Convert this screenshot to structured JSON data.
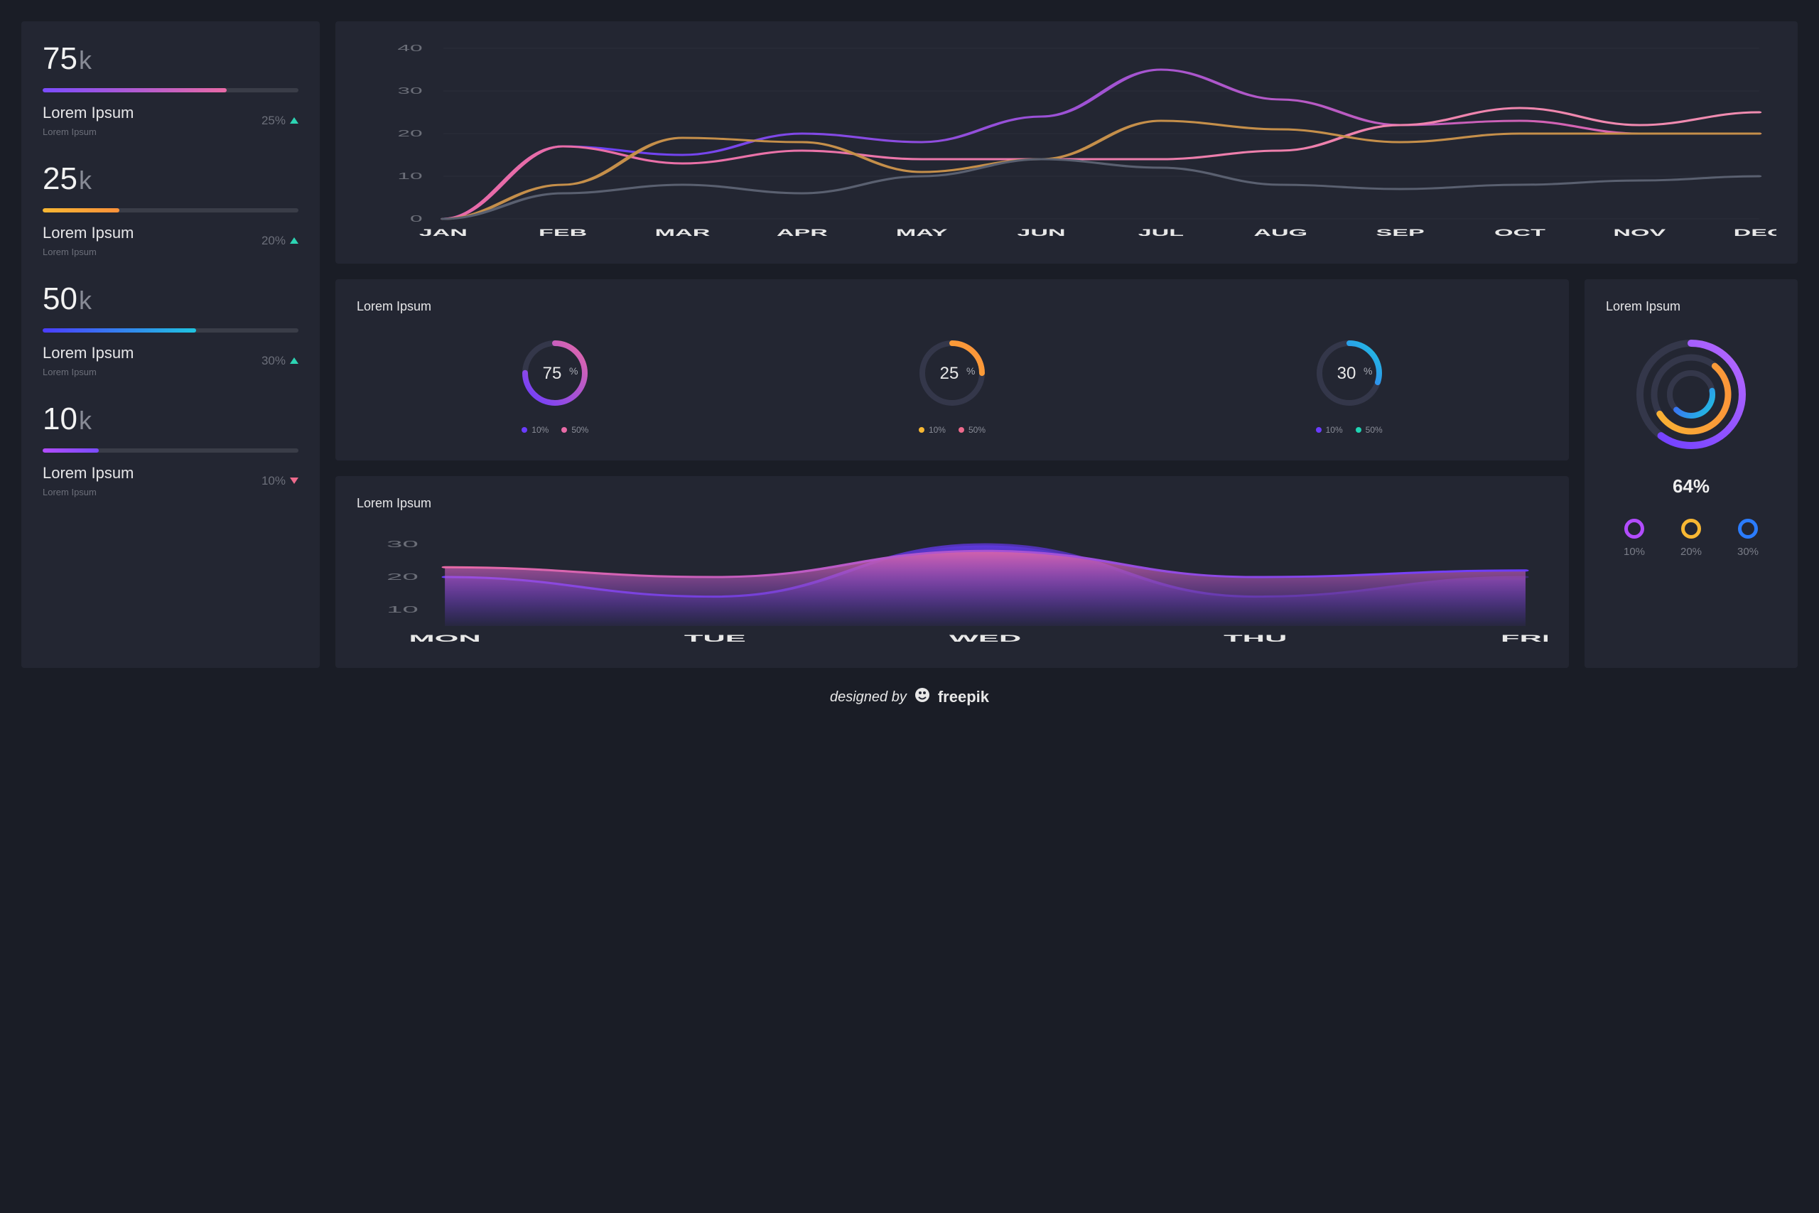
{
  "sidebar": {
    "stats": [
      {
        "value": "75",
        "unit": "k",
        "bar_pct": 72,
        "gradient": [
          "#7a4cff",
          "#e86aa6"
        ],
        "title": "Lorem Ipsum",
        "sub": "Lorem Ipsum",
        "pct": "25%",
        "dir": "up"
      },
      {
        "value": "25",
        "unit": "k",
        "bar_pct": 30,
        "gradient": [
          "#f7b733",
          "#fc913a"
        ],
        "title": "Lorem Ipsum",
        "sub": "Lorem Ipsum",
        "pct": "20%",
        "dir": "up"
      },
      {
        "value": "50",
        "unit": "k",
        "bar_pct": 60,
        "gradient": [
          "#4b3cff",
          "#1fc4e0"
        ],
        "title": "Lorem Ipsum",
        "sub": "Lorem Ipsum",
        "pct": "30%",
        "dir": "up"
      },
      {
        "value": "10",
        "unit": "k",
        "bar_pct": 22,
        "gradient": [
          "#b24cff",
          "#7a4cff"
        ],
        "title": "Lorem Ipsum",
        "sub": "Lorem Ipsum",
        "pct": "10%",
        "dir": "down"
      }
    ]
  },
  "chart_data": [
    {
      "id": "main_line",
      "type": "line",
      "categories": [
        "JAN",
        "FEB",
        "MAR",
        "APR",
        "MAY",
        "JUN",
        "JUL",
        "AUG",
        "SEP",
        "OCT",
        "NOV",
        "DEC"
      ],
      "ylim": [
        0,
        40
      ],
      "yticks": [
        0,
        10,
        20,
        30,
        40
      ],
      "series": [
        {
          "name": "purple",
          "color_from": "#5a3cff",
          "color_to": "#e86aa6",
          "values": [
            0,
            17,
            15,
            20,
            18,
            24,
            35,
            28,
            22,
            23,
            20,
            20
          ]
        },
        {
          "name": "pink",
          "color_from": "#e86aa6",
          "color_to": "#f08cb0",
          "values": [
            0,
            17,
            13,
            16,
            14,
            14,
            14,
            16,
            22,
            26,
            22,
            25
          ]
        },
        {
          "name": "amber",
          "color_from": "#c58f4a",
          "color_to": "#c58f4a",
          "values": [
            0,
            8,
            19,
            18,
            11,
            14,
            23,
            21,
            18,
            20,
            20,
            20
          ]
        },
        {
          "name": "slate",
          "color_from": "#5a6070",
          "color_to": "#5a6070",
          "values": [
            0,
            6,
            8,
            6,
            10,
            14,
            12,
            8,
            7,
            8,
            9,
            10
          ]
        }
      ]
    },
    {
      "id": "donuts",
      "title": "Lorem Ipsum",
      "type": "donut_row",
      "items": [
        {
          "percent": 75,
          "colors": [
            "#6a3cff",
            "#e86aa6"
          ],
          "legend": [
            {
              "dot": "#6a3cff",
              "label": "10%"
            },
            {
              "dot": "#e86aa6",
              "label": "50%"
            }
          ]
        },
        {
          "percent": 25,
          "colors": [
            "#f7b733",
            "#fc913a"
          ],
          "legend": [
            {
              "dot": "#f7b733",
              "label": "10%"
            },
            {
              "dot": "#ed6a8c",
              "label": "50%"
            }
          ]
        },
        {
          "percent": 30,
          "colors": [
            "#4b3cff",
            "#1fc4e0"
          ],
          "legend": [
            {
              "dot": "#6a3cff",
              "label": "10%"
            },
            {
              "dot": "#1fd4b3",
              "label": "50%"
            }
          ]
        }
      ]
    },
    {
      "id": "area_week",
      "title": "Lorem Ipsum",
      "type": "area",
      "categories": [
        "MON",
        "TUE",
        "WED",
        "THU",
        "FRI"
      ],
      "ylim": [
        5,
        35
      ],
      "yticks": [
        10,
        20,
        30
      ],
      "series": [
        {
          "name": "pink",
          "color_from": "#e86aa6",
          "color_to": "#6a3cff",
          "values": [
            23,
            20,
            28,
            20,
            22
          ]
        },
        {
          "name": "purple",
          "color_from": "#6a3cff",
          "color_to": "#3a2a70",
          "values": [
            20,
            14,
            30,
            14,
            20
          ]
        }
      ]
    },
    {
      "id": "radial",
      "title": "Lorem Ipsum",
      "type": "radial",
      "overall_pct": "64%",
      "rings": [
        {
          "percent": 60,
          "radius": 72,
          "colors": [
            "#6a3cff",
            "#b86aff"
          ]
        },
        {
          "percent": 55,
          "radius": 52,
          "colors": [
            "#f7b733",
            "#fc913a"
          ]
        },
        {
          "percent": 40,
          "radius": 30,
          "colors": [
            "#4b3cff",
            "#1fc4e0"
          ]
        }
      ],
      "minis": [
        {
          "color": "#b24cff",
          "label": "10%"
        },
        {
          "color": "#f7b733",
          "label": "20%"
        },
        {
          "color": "#2b7cff",
          "label": "30%"
        }
      ]
    }
  ],
  "footer": {
    "prefix": "designed by",
    "brand": "freepik"
  }
}
